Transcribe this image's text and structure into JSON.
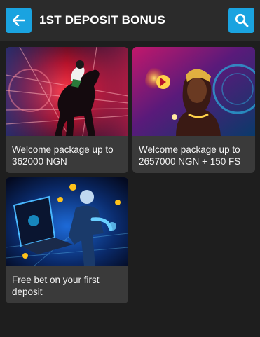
{
  "header": {
    "title": "1ST DEPOSIT BONUS",
    "back_icon": "arrow-left-icon",
    "search_icon": "search-icon",
    "accent_color": "#1aa3e0"
  },
  "promotions": [
    {
      "label": "Welcome package up to 362000 NGN",
      "image": "horse-racing-jockey"
    },
    {
      "label": "Welcome package up to 2657000 NGN + 150 FS",
      "image": "fortune-teller-roulette"
    },
    {
      "label": "Free bet on your first deposit",
      "image": "esports-player-laptop"
    }
  ]
}
